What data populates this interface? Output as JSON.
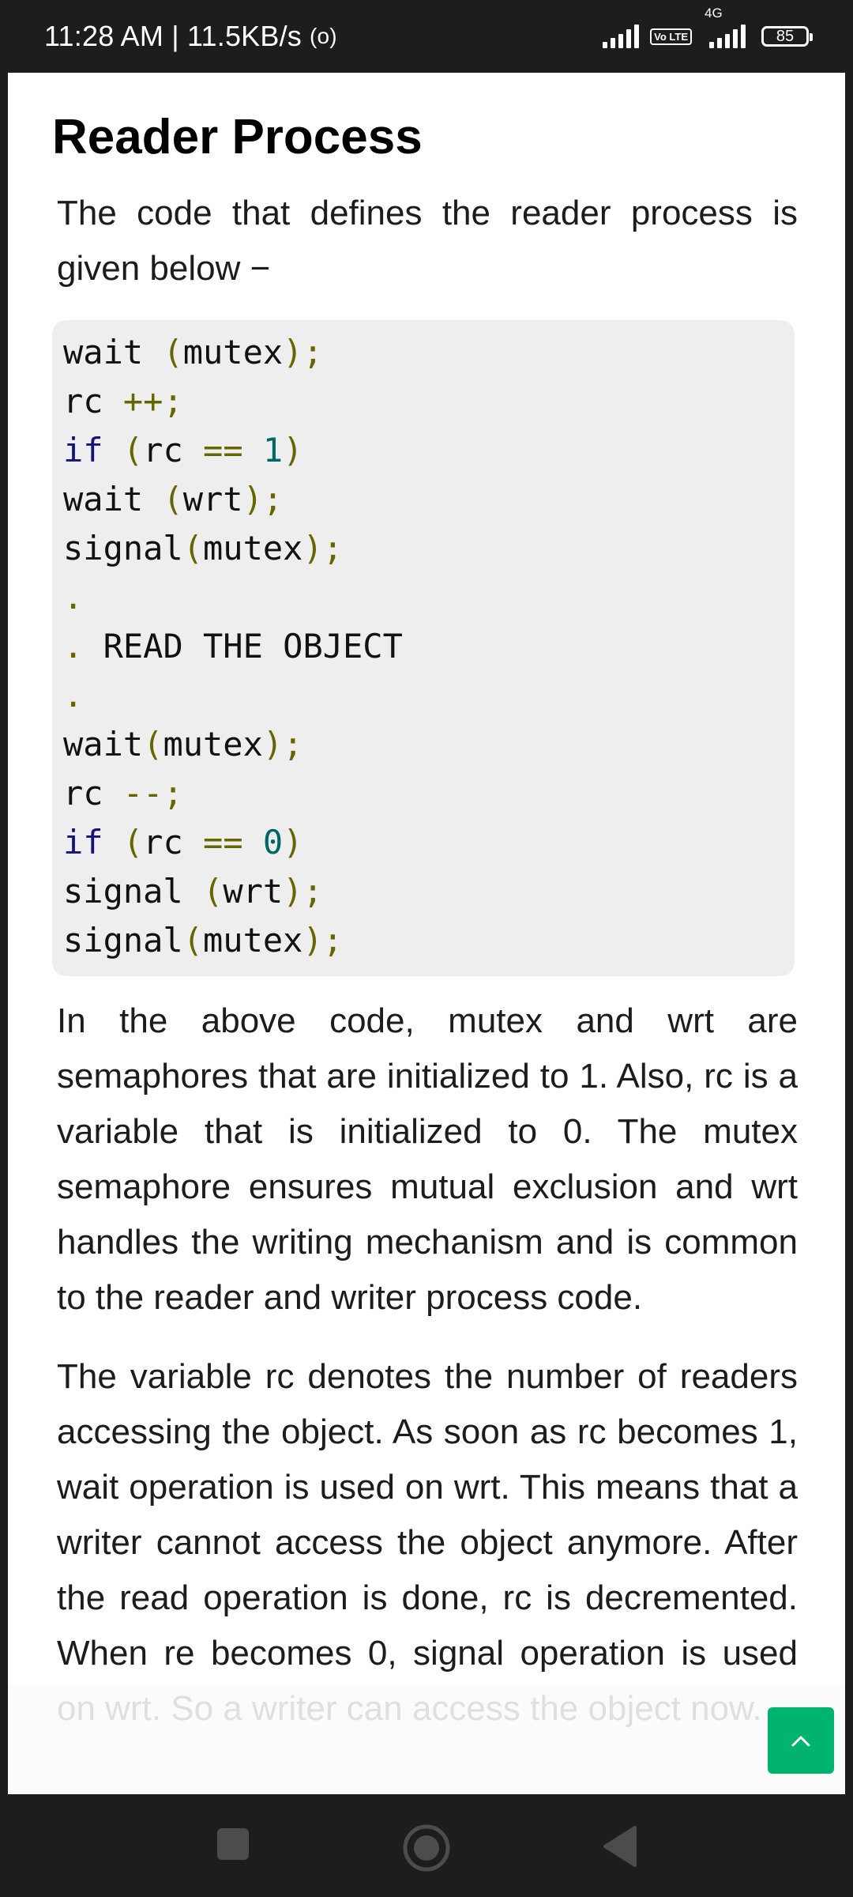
{
  "status_bar": {
    "time_and_speed": "11:28 AM | 11.5KB/s",
    "network_label": "4G",
    "volte_label": "Vo LTE",
    "battery_level": "85"
  },
  "article": {
    "heading": "Reader Process",
    "intro": "The code that defines the reader process is given below −",
    "code_lines": [
      "wait (mutex);",
      "rc ++;",
      "if (rc == 1)",
      "wait (wrt);",
      "signal(mutex);",
      ".",
      ". READ THE OBJECT",
      ".",
      "wait(mutex);",
      "rc --;",
      "if (rc == 0)",
      "signal (wrt);",
      "signal(mutex);"
    ],
    "paragraph_2": "In the above code, mutex and wrt are semaphores that are initialized to 1. Also, rc is a variable that is initialized to 0. The mutex semaphore ensures mutual exclusion and wrt handles the writing mechanism and is common to the reader and writer process code.",
    "paragraph_3": "The variable rc denotes the number of readers accessing the object. As soon as rc becomes 1, wait operation is used on wrt. This means that a writer cannot access the object anymore. After the read operation is done, rc is decremented. When re becomes 0, signal operation is used on wrt. So a writer can access the object now."
  },
  "colors": {
    "accent_green": "#00b46e",
    "code_background": "#eeeeee",
    "keyword": "#12127a",
    "number": "#006666",
    "punctuation": "#666600"
  },
  "icons": {
    "scroll_top": "chevron-up-icon",
    "nav_recents": "square-icon",
    "nav_home": "circle-icon",
    "nav_back": "triangle-back-icon"
  }
}
